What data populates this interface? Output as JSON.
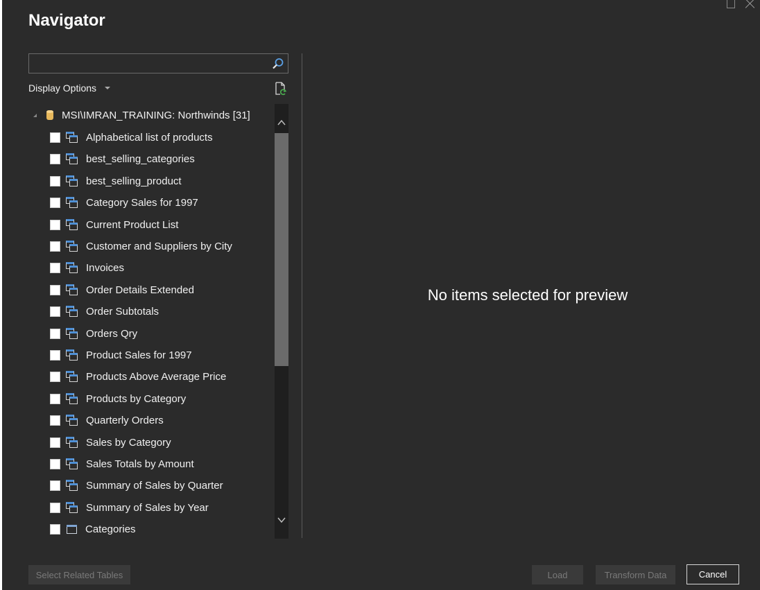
{
  "window": {
    "title": "Navigator"
  },
  "search": {
    "value": "",
    "placeholder": ""
  },
  "toolbar": {
    "display_options_label": "Display Options"
  },
  "tree": {
    "root": {
      "label": "MSI\\IMRAN_TRAINING: Northwinds [31]",
      "icon": "database-icon",
      "expanded": true
    },
    "items": [
      {
        "label": "Alphabetical list of products",
        "icon": "view-icon",
        "checked": false
      },
      {
        "label": "best_selling_categories",
        "icon": "view-icon",
        "checked": false
      },
      {
        "label": "best_selling_product",
        "icon": "view-icon",
        "checked": false
      },
      {
        "label": "Category Sales for 1997",
        "icon": "view-icon",
        "checked": false
      },
      {
        "label": "Current Product List",
        "icon": "view-icon",
        "checked": false
      },
      {
        "label": "Customer and Suppliers by City",
        "icon": "view-icon",
        "checked": false
      },
      {
        "label": "Invoices",
        "icon": "view-icon",
        "checked": false
      },
      {
        "label": "Order Details Extended",
        "icon": "view-icon",
        "checked": false
      },
      {
        "label": "Order Subtotals",
        "icon": "view-icon",
        "checked": false
      },
      {
        "label": "Orders Qry",
        "icon": "view-icon",
        "checked": false
      },
      {
        "label": "Product Sales for 1997",
        "icon": "view-icon",
        "checked": false
      },
      {
        "label": "Products Above Average Price",
        "icon": "view-icon",
        "checked": false
      },
      {
        "label": "Products by Category",
        "icon": "view-icon",
        "checked": false
      },
      {
        "label": "Quarterly Orders",
        "icon": "view-icon",
        "checked": false
      },
      {
        "label": "Sales by Category",
        "icon": "view-icon",
        "checked": false
      },
      {
        "label": "Sales Totals by Amount",
        "icon": "view-icon",
        "checked": false
      },
      {
        "label": "Summary of Sales by Quarter",
        "icon": "view-icon",
        "checked": false
      },
      {
        "label": "Summary of Sales by Year",
        "icon": "view-icon",
        "checked": false
      },
      {
        "label": "Categories",
        "icon": "table-icon",
        "checked": false
      }
    ]
  },
  "preview": {
    "message": "No items selected for preview"
  },
  "footer": {
    "select_related_label": "Select Related Tables",
    "load_label": "Load",
    "transform_label": "Transform Data",
    "cancel_label": "Cancel"
  },
  "colors": {
    "background": "#2b2b2b",
    "accent_blue": "#4d8fd6",
    "database_gold": "#e7b85c"
  }
}
